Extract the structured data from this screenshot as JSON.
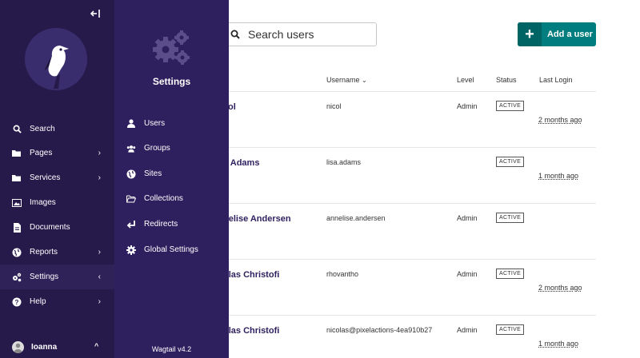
{
  "search": {
    "placeholder": "Search users"
  },
  "add_button": {
    "label": "Add a user",
    "plus": "+"
  },
  "table": {
    "headers": {
      "username": "Username",
      "level": "Level",
      "status": "Status",
      "last_login": "Last Login"
    },
    "rows": [
      {
        "name": "ol",
        "username": "nicol",
        "level": "Admin",
        "status": "ACTIVE",
        "last_login": "2 months ago"
      },
      {
        "name": "a Adams",
        "username": "lisa.adams",
        "level": "",
        "status": "ACTIVE",
        "last_login": "1 month ago"
      },
      {
        "name": "nelise Andersen",
        "username": "annelise.andersen",
        "level": "Admin",
        "status": "ACTIVE",
        "last_login": ""
      },
      {
        "name": "olas Christofi",
        "username": "rhovantho",
        "level": "Admin",
        "status": "ACTIVE",
        "last_login": "2 months ago"
      },
      {
        "name": "olas Christofi",
        "username": "nicolas@pixelactions-4ea910b27",
        "level": "Admin",
        "status": "ACTIVE",
        "last_login": "1 month ago"
      }
    ]
  },
  "sidebar": {
    "items": [
      {
        "label": "Search",
        "icon": "search-icon",
        "chevron": ""
      },
      {
        "label": "Pages",
        "icon": "folder-icon",
        "chevron": "›"
      },
      {
        "label": "Services",
        "icon": "folder-icon",
        "chevron": "›"
      },
      {
        "label": "Images",
        "icon": "image-icon",
        "chevron": ""
      },
      {
        "label": "Documents",
        "icon": "document-icon",
        "chevron": ""
      },
      {
        "label": "Reports",
        "icon": "globe-icon",
        "chevron": "›"
      },
      {
        "label": "Settings",
        "icon": "cogs-icon",
        "chevron": "‹"
      },
      {
        "label": "Help",
        "icon": "help-icon",
        "chevron": "›"
      }
    ],
    "account": {
      "name": "Ioanna",
      "chevron": "^"
    }
  },
  "submenu": {
    "title": "Settings",
    "items": [
      {
        "label": "Users",
        "icon": "user-icon"
      },
      {
        "label": "Groups",
        "icon": "group-icon"
      },
      {
        "label": "Sites",
        "icon": "globe-icon"
      },
      {
        "label": "Collections",
        "icon": "folder-open-icon"
      },
      {
        "label": "Redirects",
        "icon": "redirect-icon"
      },
      {
        "label": "Global Settings",
        "icon": "cog-icon"
      }
    ],
    "version": "Wagtail v4.2"
  },
  "colors": {
    "sidebar": "#261a4b",
    "submenu": "#2e1f5e",
    "accent": "#007d7e",
    "link": "#2e1f5e"
  }
}
